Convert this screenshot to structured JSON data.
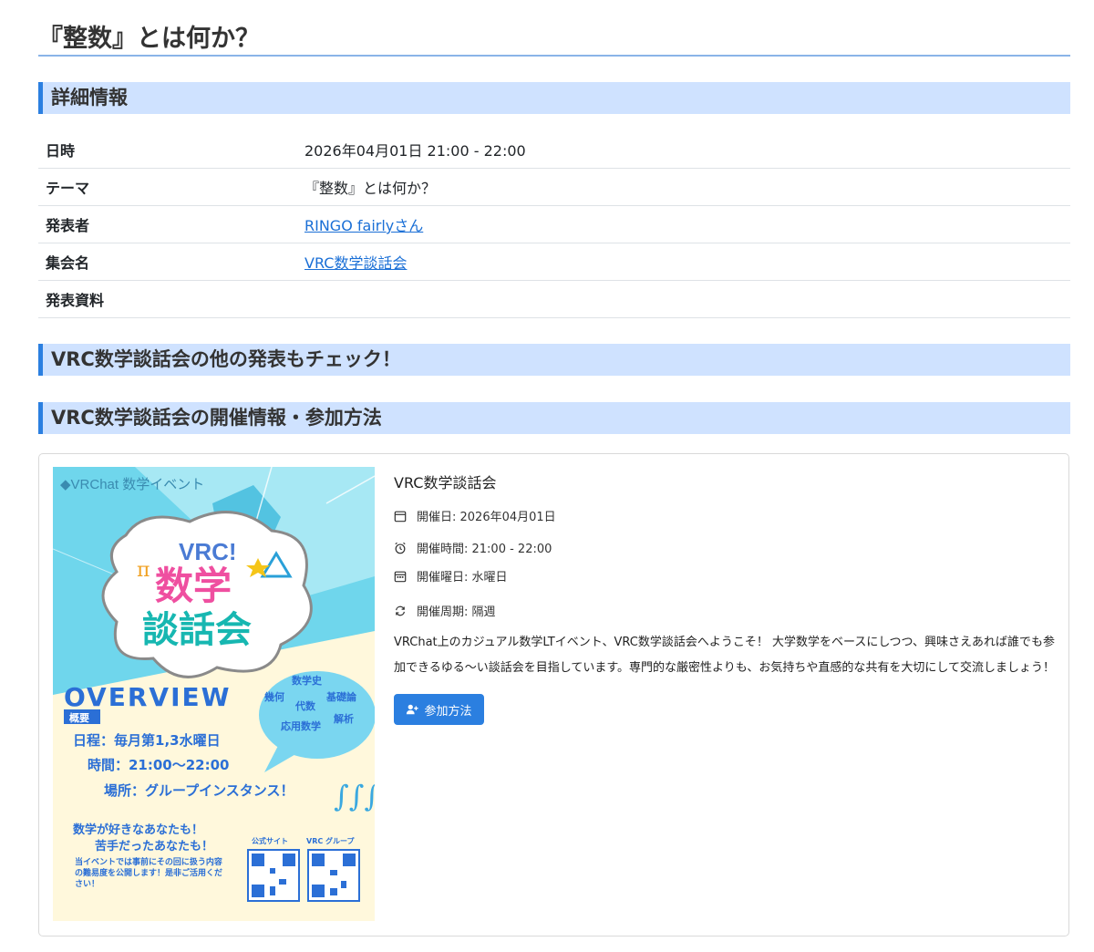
{
  "page": {
    "title": "『整数』とは何か？"
  },
  "sections": {
    "details": "詳細情報",
    "other_talks": "VRC数学談話会の他の発表もチェック！",
    "event_info": "VRC数学談話会の開催情報・参加方法"
  },
  "details": {
    "rows": [
      {
        "label": "日時",
        "value": "2026年04月01日 21:00 - 22:00"
      },
      {
        "label": "テーマ",
        "value": "『整数』とは何か？"
      },
      {
        "label": "発表者",
        "value": "RINGO fairlyさん"
      },
      {
        "label": "集会名",
        "value": "VRC数学談話会"
      },
      {
        "label": "発表資料",
        "value": ""
      }
    ]
  },
  "event": {
    "name": "VRC数学談話会",
    "date_label": "開催日: 2026年04月01日",
    "time_label": "開催時間: 21:00 - 22:00",
    "weekday_label": "開催曜日: 水曜日",
    "cycle_label": "開催周期: 隔週",
    "description": "VRChat上のカジュアル数学LTイベント、VRC数学談話会へようこそ！ 大学数学をベースにしつつ、興味さえあれば誰でも参加できるゆる〜い談話会を目指しています。専門的な厳密性よりも、お気持ちや直感的な共有を大切にして交流しましょう！",
    "join_button": "参加方法"
  },
  "poster": {
    "top_label": "◆VRChat 数学イベント",
    "logo_vrc": "VRC!",
    "logo_line1": "数学",
    "logo_line2": "談話会",
    "overview": "OVERVIEW",
    "overview_sub": "概要",
    "schedule": "日程：毎月第1,3水曜日",
    "time": "時間：21:00～22:00",
    "place": "場所：グループインスタンス！",
    "topics": [
      "数学史",
      "幾何",
      "代数",
      "基礎論",
      "応用数学",
      "解析"
    ],
    "catch1": "数学が好きなあなたも！",
    "catch2": "苦手だったあなたも！",
    "note": "当イベントでは事前にその回に扱う内容の難易度を公開します！是非ご活用ください！",
    "qr1_label": "公式サイト",
    "qr2_label": "VRC グループ"
  },
  "colors": {
    "accent": "#2b7fe0",
    "section_bg": "#cfe2ff",
    "link": "#1a6fd6",
    "poster_cyan": "#4ec8e0",
    "poster_pink": "#ef4fa0"
  },
  "icons": [
    "calendar-icon",
    "alarm-clock-icon",
    "calendar-week-icon",
    "repeat-icon",
    "person-plus-icon"
  ]
}
